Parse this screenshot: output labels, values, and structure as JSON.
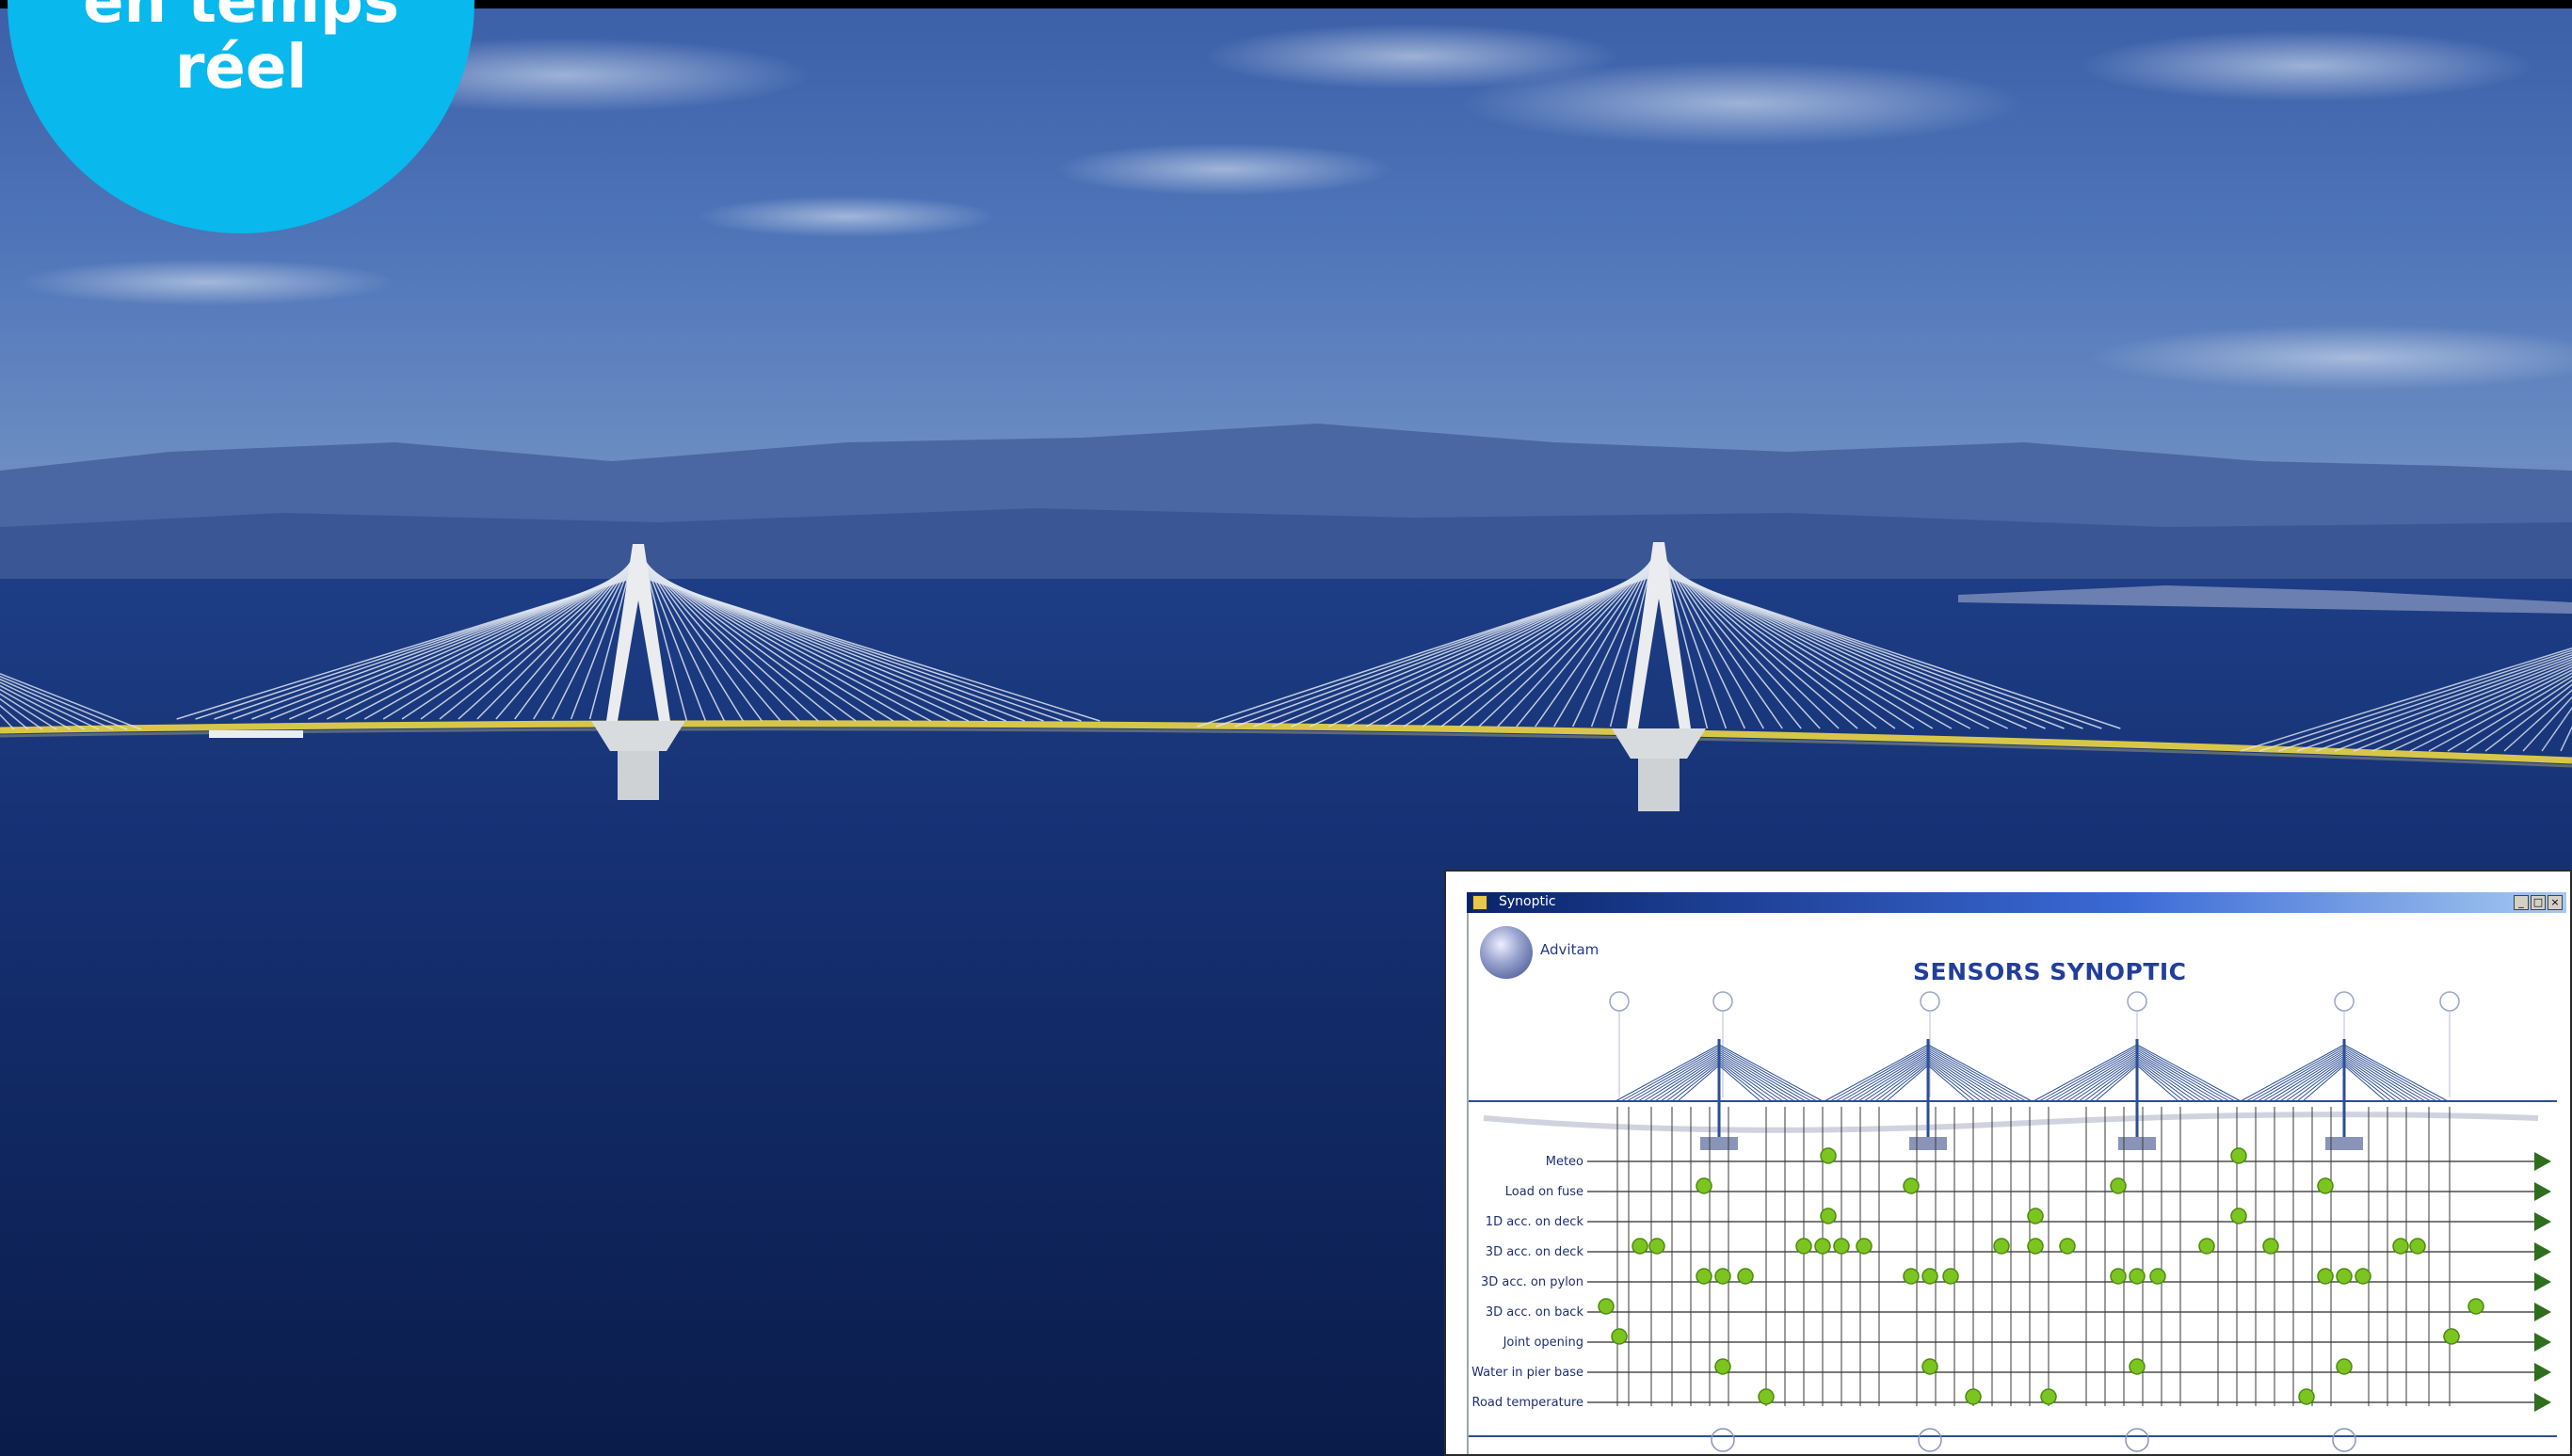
{
  "badge": {
    "line1": "en temps",
    "line2": "réel",
    "color": "#09b8ec"
  },
  "window": {
    "title": "Synoptic",
    "buttons": [
      "_",
      "□",
      "×"
    ],
    "logo_text": "Advitam",
    "heading": "SENSORS SYNOPTIC"
  },
  "sensor_rows": [
    "Meteo",
    "Load on fuse",
    "1D acc. on deck",
    "3D acc. on deck",
    "3D acc. on pylon",
    "3D acc. on back",
    "Joint opening",
    "Water in pier base",
    "Road temperature"
  ],
  "colors": {
    "sensor": "#7cc41f",
    "arrow": "#2f6e1e",
    "structure": "#2c4e95"
  }
}
